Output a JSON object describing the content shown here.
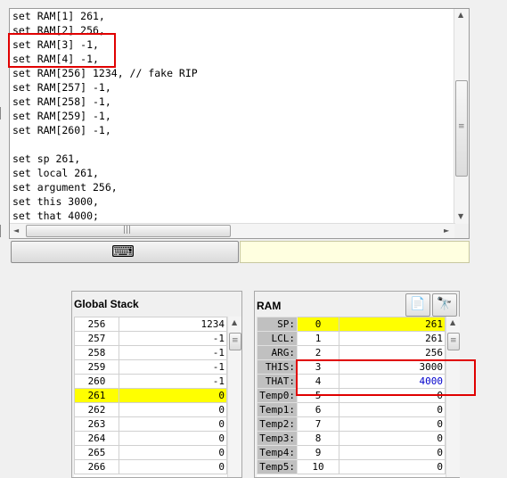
{
  "script": {
    "lines": [
      "set RAM[1] 261,",
      "set RAM[2] 256,",
      "set RAM[3] -1,",
      "set RAM[4] -1,",
      "set RAM[256] 1234, // fake RIP",
      "set RAM[257] -1,",
      "set RAM[258] -1,",
      "set RAM[259] -1,",
      "set RAM[260] -1,",
      "",
      "set sp 261,",
      "set local 261,",
      "set argument 256,",
      "set this 3000,",
      "set that 4000;"
    ]
  },
  "scroll_glyphs": {
    "up": "▲",
    "down": "▼",
    "left": "◄",
    "right": "►",
    "grip_v": "≡",
    "grip_h": "|||"
  },
  "keyboard": {
    "icon": "keyboard-icon",
    "glyph": "⌨"
  },
  "status_text": "",
  "global_stack": {
    "title": "Global Stack",
    "rows": [
      {
        "addr": "256",
        "value": "1234"
      },
      {
        "addr": "257",
        "value": "-1"
      },
      {
        "addr": "258",
        "value": "-1"
      },
      {
        "addr": "259",
        "value": "-1"
      },
      {
        "addr": "260",
        "value": "-1"
      },
      {
        "addr": "261",
        "value": "0",
        "highlight": true
      },
      {
        "addr": "262",
        "value": "0"
      },
      {
        "addr": "263",
        "value": "0"
      },
      {
        "addr": "264",
        "value": "0"
      },
      {
        "addr": "265",
        "value": "0"
      },
      {
        "addr": "266",
        "value": "0"
      }
    ]
  },
  "ram": {
    "title": "RAM",
    "toolbar": {
      "load_icon": "load-file-icon",
      "load_glyph": "📄",
      "find_icon": "binoculars-icon",
      "find_glyph": "🔭"
    },
    "rows": [
      {
        "name": "SP:",
        "addr": "0",
        "value": "261",
        "highlight": true
      },
      {
        "name": "LCL:",
        "addr": "1",
        "value": "261"
      },
      {
        "name": "ARG:",
        "addr": "2",
        "value": "256"
      },
      {
        "name": "THIS:",
        "addr": "3",
        "value": "3000"
      },
      {
        "name": "THAT:",
        "addr": "4",
        "value": "4000",
        "value_color": "#0000cc"
      },
      {
        "name": "Temp0:",
        "addr": "5",
        "value": "0"
      },
      {
        "name": "Temp1:",
        "addr": "6",
        "value": "0"
      },
      {
        "name": "Temp2:",
        "addr": "7",
        "value": "0"
      },
      {
        "name": "Temp3:",
        "addr": "8",
        "value": "0"
      },
      {
        "name": "Temp4:",
        "addr": "9",
        "value": "0"
      },
      {
        "name": "Temp5:",
        "addr": "10",
        "value": "0"
      }
    ]
  },
  "colors": {
    "highlight": "#ffff00",
    "annotation": "#e00000",
    "status_bg": "#ffffe0"
  }
}
